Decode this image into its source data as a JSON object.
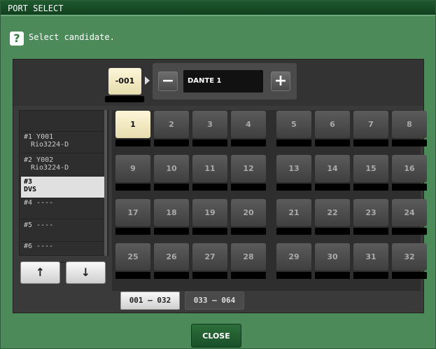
{
  "window": {
    "title": "PORT SELECT"
  },
  "help": {
    "icon": "?",
    "instruction": "Select candidate."
  },
  "channel": {
    "id": "-001"
  },
  "port_selector": {
    "minus": "−",
    "plus": "+",
    "name": "DANTE 1"
  },
  "devices": [
    {
      "line1": "",
      "line2": ""
    },
    {
      "line1": "#1 Y001",
      "line2": "Rio3224-D"
    },
    {
      "line1": "#2 Y002",
      "line2": "Rio3224-D"
    },
    {
      "line1": "#3",
      "line2": "DVS",
      "selected": true
    },
    {
      "line1": "#4 ----",
      "line2": ""
    },
    {
      "line1": "#5 ----",
      "line2": ""
    },
    {
      "line1": "#6 ----",
      "line2": ""
    }
  ],
  "nav": {
    "up": "↑",
    "down": "↓"
  },
  "ports": [
    "1",
    "2",
    "3",
    "4",
    "5",
    "6",
    "7",
    "8",
    "9",
    "10",
    "11",
    "12",
    "13",
    "14",
    "15",
    "16",
    "17",
    "18",
    "19",
    "20",
    "21",
    "22",
    "23",
    "24",
    "25",
    "26",
    "27",
    "28",
    "29",
    "30",
    "31",
    "32"
  ],
  "selected_port": "1",
  "pages": {
    "tab1": "001 – 032",
    "tab2": "033 – 064",
    "active": "tab1"
  },
  "close_label": "CLOSE"
}
